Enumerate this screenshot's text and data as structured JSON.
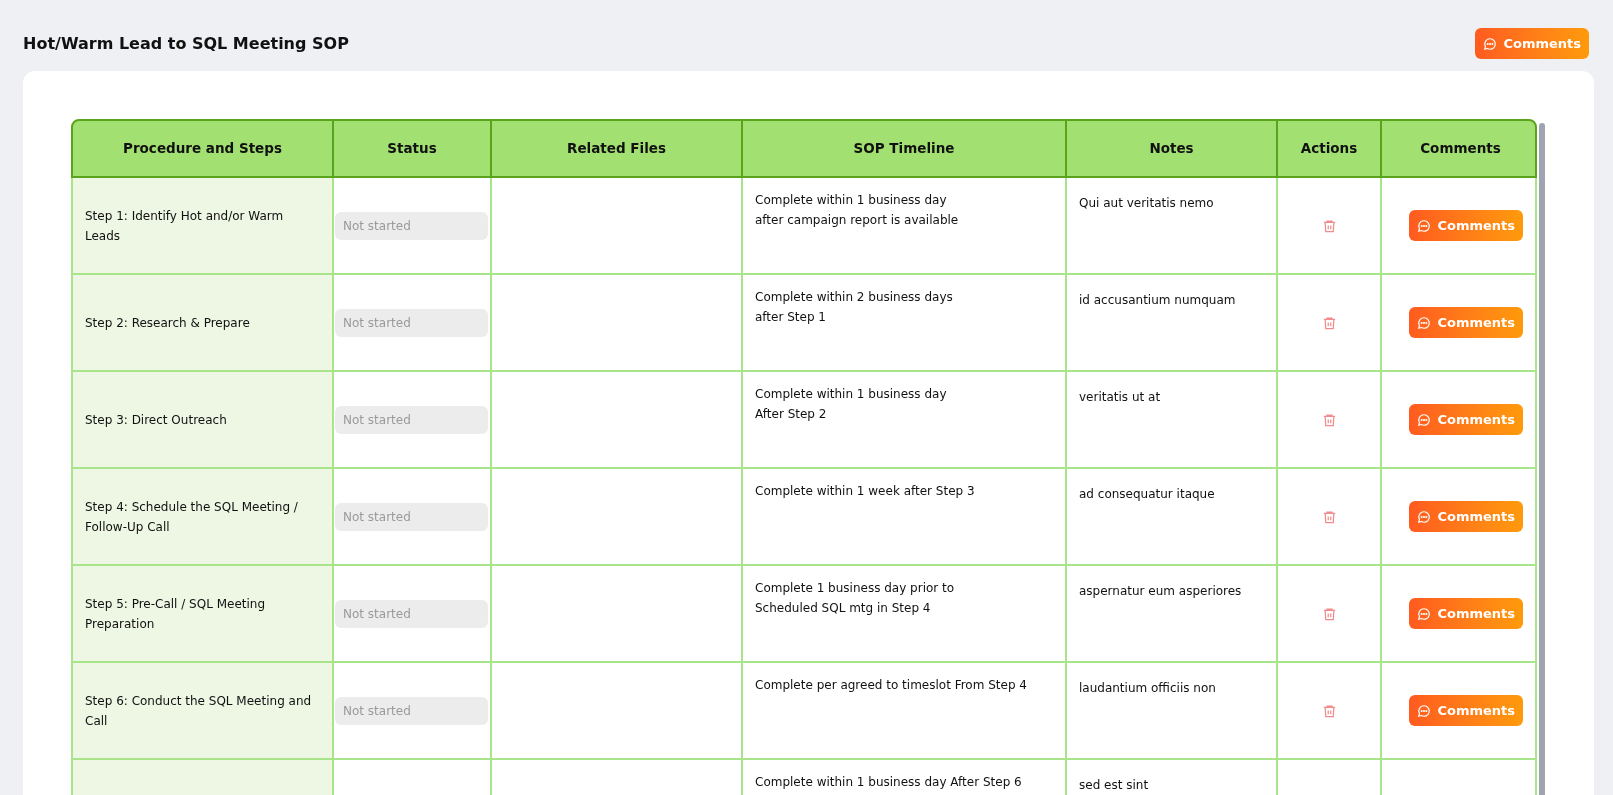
{
  "page": {
    "title": "Hot/Warm Lead to SQL Meeting SOP",
    "comments_button": "Comments"
  },
  "table": {
    "columns": [
      "Procedure and Steps",
      "Status",
      "Related Files",
      "SOP Timeline",
      "Notes",
      "Actions",
      "Comments"
    ],
    "rows": [
      {
        "step": "Step 1: Identify Hot and/or Warm Leads",
        "status": "Not started",
        "timeline": [
          "Complete within 1 business day",
          "after campaign report is available"
        ],
        "notes": "Qui aut veritatis nemo",
        "comments": "Comments"
      },
      {
        "step": "Step 2: Research & Prepare",
        "status": "Not started",
        "timeline": [
          "Complete within 2 business days",
          "after Step 1"
        ],
        "notes": "id accusantium numquam",
        "comments": "Comments"
      },
      {
        "step": "Step 3: Direct Outreach",
        "status": "Not started",
        "timeline": [
          "Complete within 1 business day",
          "After Step 2"
        ],
        "notes": "veritatis ut at",
        "comments": "Comments"
      },
      {
        "step": "Step 4: Schedule the SQL Meeting / Follow-Up Call",
        "status": "Not started",
        "timeline": [
          "Complete within 1 week after Step 3"
        ],
        "notes": "ad consequatur itaque",
        "comments": "Comments"
      },
      {
        "step": "Step 5: Pre-Call / SQL Meeting Preparation",
        "status": "Not started",
        "timeline": [
          "Complete 1 business day prior to",
          "Scheduled SQL mtg in Step 4"
        ],
        "notes": "aspernatur eum asperiores",
        "comments": "Comments"
      },
      {
        "step": "Step 6: Conduct the SQL Meeting and Call",
        "status": "Not started",
        "timeline": [
          "Complete per agreed to timeslot From Step 4"
        ],
        "notes": "laudantium officiis non",
        "comments": "Comments"
      },
      {
        "timeline": [
          "Complete within 1 business day After Step 6"
        ],
        "notes": "sed est sint"
      }
    ]
  }
}
